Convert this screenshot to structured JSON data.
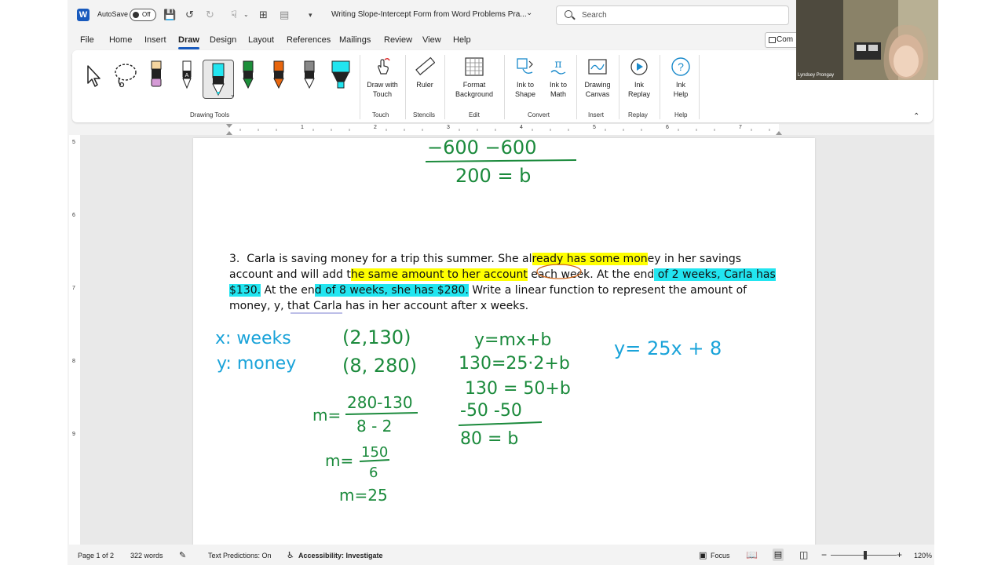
{
  "titlebar": {
    "autosave_label": "AutoSave",
    "autosave_state": "Off",
    "doc_title": "Writing Slope-Intercept Form from Word Problems Pra...",
    "search_placeholder": "Search",
    "comments_label": "Com"
  },
  "menu": {
    "tabs": [
      "File",
      "Home",
      "Insert",
      "Draw",
      "Design",
      "Layout",
      "References",
      "Mailings",
      "Review",
      "View",
      "Help"
    ],
    "active": "Draw"
  },
  "ribbon": {
    "groups": {
      "drawing_tools": "Drawing Tools",
      "touch": "Touch",
      "stencils": "Stencils",
      "edit": "Edit",
      "convert": "Convert",
      "insert": "Insert",
      "replay": "Replay",
      "help": "Help"
    },
    "buttons": {
      "draw_with_touch": [
        "Draw with",
        "Touch"
      ],
      "ruler": [
        "Ruler"
      ],
      "format_background": [
        "Format",
        "Background"
      ],
      "ink_to_shape": [
        "Ink to",
        "Shape"
      ],
      "ink_to_math": [
        "Ink to",
        "Math"
      ],
      "drawing_canvas": [
        "Drawing",
        "Canvas"
      ],
      "ink_replay": [
        "Ink",
        "Replay"
      ],
      "ink_help": [
        "Ink",
        "Help"
      ]
    },
    "pen_colors": [
      "#222222",
      "#1d8f3a",
      "#e8660e",
      "#888888",
      "#22e5f0"
    ]
  },
  "ruler": {
    "numbers": [
      "1",
      "2",
      "3",
      "4",
      "5",
      "6",
      "7"
    ],
    "vertical_numbers": [
      "5",
      "6",
      "7",
      "8",
      "9"
    ]
  },
  "document": {
    "problem": {
      "number": "3.",
      "text_segments": [
        {
          "t": "Carla is saving money for a trip this summer.  She al",
          "hl": ""
        },
        {
          "t": "ready has some mon",
          "hl": "y"
        },
        {
          "t": "ey in her savings account and will add t",
          "hl": ""
        },
        {
          "t": "he same amount to her account",
          "hl": "y"
        },
        {
          "t": " each week.  At the end",
          "hl": ""
        },
        {
          "t": " of 2 weeks, Carla has $130.",
          "hl": "c"
        },
        {
          "t": "  At the en",
          "hl": ""
        },
        {
          "t": "d of 8 weeks, she has $280.",
          "hl": "c"
        },
        {
          "t": "  Write a linear function to represent the amount of money, y, that Carla has in her account after x weeks.",
          "hl": ""
        }
      ]
    },
    "handwriting": {
      "prev_line1": "−600  −600",
      "prev_line2": "200 = b",
      "x_def": "x: weeks",
      "y_def": "y: money",
      "point1": "(2,130)",
      "point2": "(8, 280)",
      "slope_label": "m=",
      "slope_num": "280-130",
      "slope_den": "8 - 2",
      "slope2_num": "150",
      "slope2_den": "6",
      "slope_result": "m=25",
      "eq1": "y=mx+b",
      "eq2": "130=25·2+b",
      "eq3": "130 = 50+b",
      "eq4": "-50  -50",
      "eq5": "80 = b",
      "final": "y= 25x + 8"
    },
    "ink_colors": {
      "green": "#1b8a3c",
      "blue": "#1aa3d9",
      "orange": "#d2691e"
    }
  },
  "statusbar": {
    "page": "Page 1 of 2",
    "words": "322 words",
    "text_predictions": "Text Predictions: On",
    "accessibility": "Accessibility: Investigate",
    "focus": "Focus",
    "zoom": "120%"
  },
  "webcam": {
    "name": "Lyndsey Prongay"
  }
}
